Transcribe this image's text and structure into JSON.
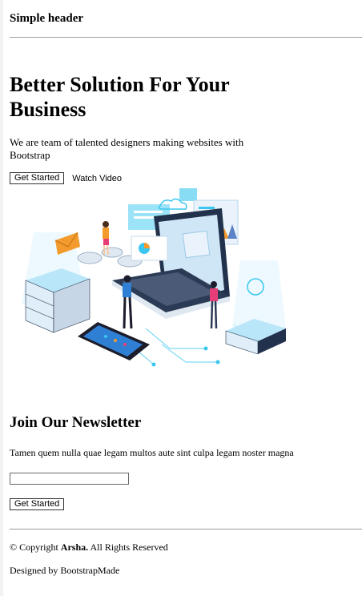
{
  "header": {
    "title": "Simple header"
  },
  "hero": {
    "title": "Better Solution For Your Business",
    "text": "We are team of talented designers making websites with Bootstrap",
    "get_started": "Get Started",
    "watch_video": "Watch Video"
  },
  "newsletter": {
    "title": "Join Our Newsletter",
    "text": "Tamen quem nulla quae legam multos aute sint culpa legam noster magna",
    "email_value": "",
    "button": "Get Started"
  },
  "footer": {
    "copy_prefix": "© Copyright ",
    "brand": "Arsha.",
    "copy_suffix": " All Rights Reserved",
    "designed_by": "Designed by BootstrapMade"
  },
  "colors": {
    "accent": "#39c7ef",
    "navy": "#23324c",
    "orange": "#f39c2d"
  }
}
